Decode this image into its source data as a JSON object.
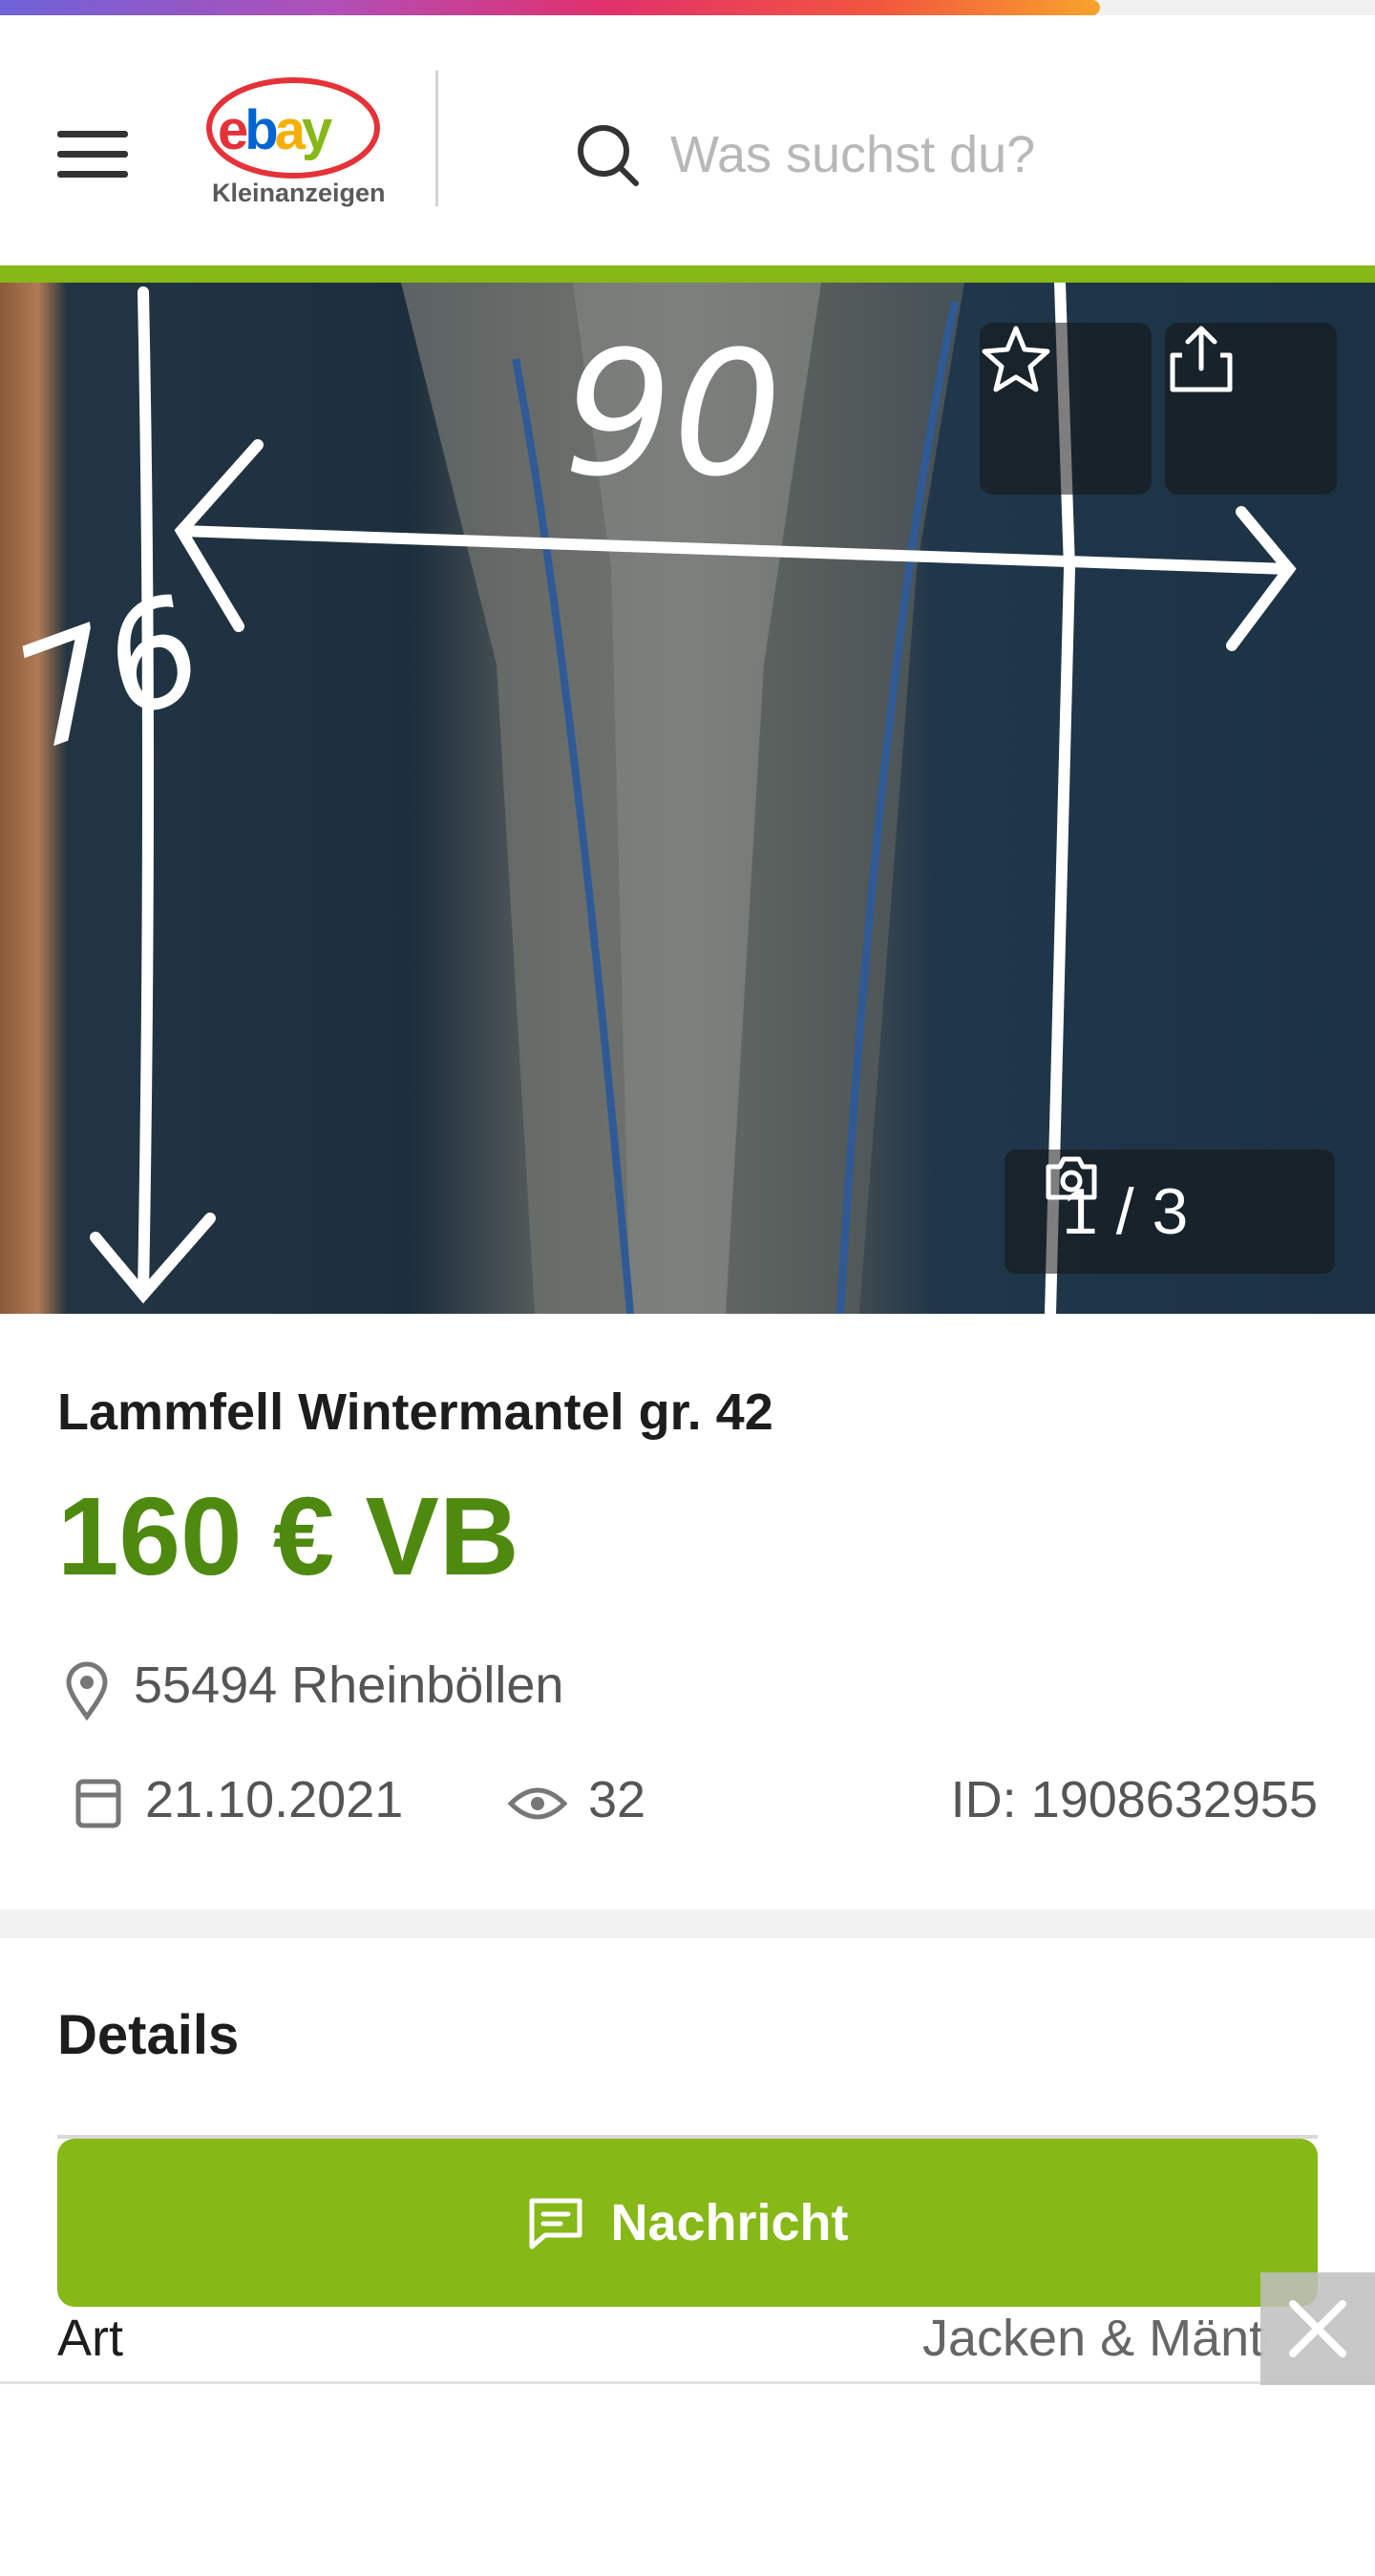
{
  "header": {
    "logo_alt": "ebay Kleinanzeigen",
    "logo_word": "ebay",
    "logo_sub": "Kleinanzeigen",
    "search_placeholder": "Was suchst du?"
  },
  "loading_progress": 0.8,
  "gallery": {
    "counter": "1 / 3",
    "photo_annotations": [
      "90",
      "76"
    ]
  },
  "listing": {
    "title": "Lammfell Wintermantel gr. 42",
    "price": "160 € VB",
    "location": "55494 Rheinböllen",
    "date": "21.10.2021",
    "views": "32",
    "id_label": "ID: 1908632955"
  },
  "details": {
    "heading": "Details",
    "rows": [
      {
        "label": "Art",
        "value": "Jacken & Mäntel"
      }
    ]
  },
  "actions": {
    "message_label": "Nachricht"
  },
  "colors": {
    "brand_green": "#86b817",
    "price_green": "#4f8a10"
  },
  "icons": [
    "menu-icon",
    "search-icon",
    "star-icon",
    "share-icon",
    "camera-icon",
    "location-pin-icon",
    "calendar-icon",
    "eye-icon",
    "chat-icon",
    "close-icon"
  ]
}
